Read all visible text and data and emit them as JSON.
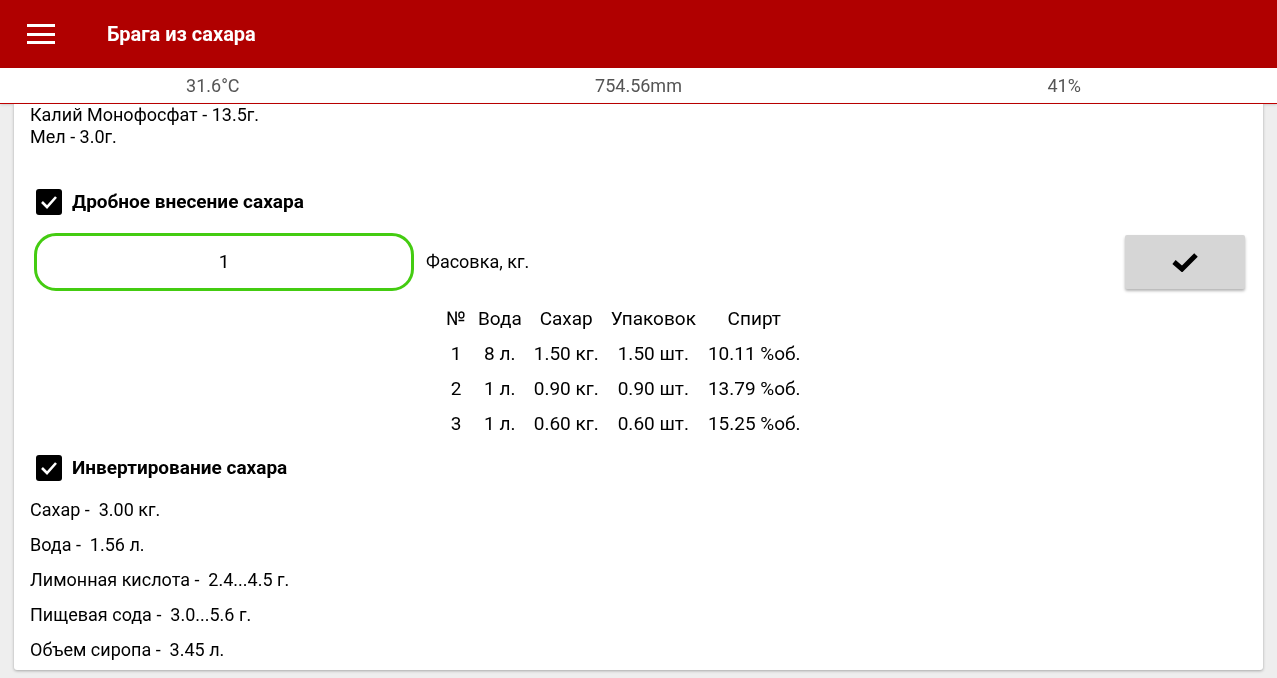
{
  "app_bar": {
    "title": "Брага из сахара"
  },
  "status_bar": [
    "31.6°C",
    "754.56mm",
    "41%"
  ],
  "ingredients": [
    "Калий Монофосфат - 13.5г.",
    "Мел - 3.0г."
  ],
  "fractional": {
    "label": "Дробное внесение сахара",
    "checked": true,
    "value": "1",
    "field_label": "Фасовка, кг."
  },
  "table": {
    "columns": [
      "№",
      "Вода",
      "Сахар",
      "Упаковок",
      "Спирт"
    ],
    "rows": [
      [
        "1",
        "8 л.",
        "1.50 кг.",
        "1.50 шт.",
        "10.11 %об."
      ],
      [
        "2",
        "1 л.",
        "0.90 кг.",
        "0.90 шт.",
        "13.79 %об."
      ],
      [
        "3",
        "1 л.",
        "0.60 кг.",
        "0.60 шт.",
        "15.25 %об."
      ]
    ]
  },
  "inversion": {
    "label": "Инвертирование сахара",
    "checked": true,
    "lines": [
      "Сахар -  3.00 кг.",
      "Вода -  1.56 л.",
      "Лимонная кислота -  2.4...4.5 г.",
      "Пищевая сода -  3.0...5.6 г.",
      "Объем сиропа -  3.45 л."
    ]
  }
}
